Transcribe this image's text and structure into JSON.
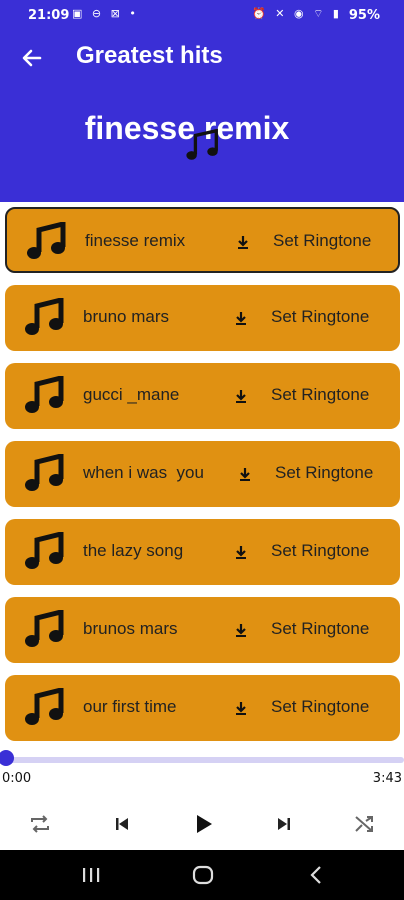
{
  "status_bar": {
    "time": "21:09",
    "left_icons": "▣ ⊖ ⊠ •",
    "right_icons": "⏰ ✕ ◉ ⌔ ▮",
    "battery": "95%"
  },
  "header": {
    "title": "Greatest hits",
    "now_playing": "finesse remix"
  },
  "songs": [
    {
      "title": "finesse remix",
      "action": "Set Ringtone"
    },
    {
      "title": "bruno mars",
      "action": "Set Ringtone"
    },
    {
      "title": "gucci _mane",
      "action": "Set Ringtone"
    },
    {
      "title": "when i was  you",
      "action": "Set Ringtone"
    },
    {
      "title": "the lazy song",
      "action": "Set Ringtone"
    },
    {
      "title": "brunos mars",
      "action": "Set Ringtone"
    },
    {
      "title": "our first time",
      "action": "Set Ringtone"
    }
  ],
  "player": {
    "current_time": "0:00",
    "total_time": "3:43",
    "progress": 0.0
  },
  "colors": {
    "accent": "#3a2fd6",
    "card": "#e09112"
  }
}
